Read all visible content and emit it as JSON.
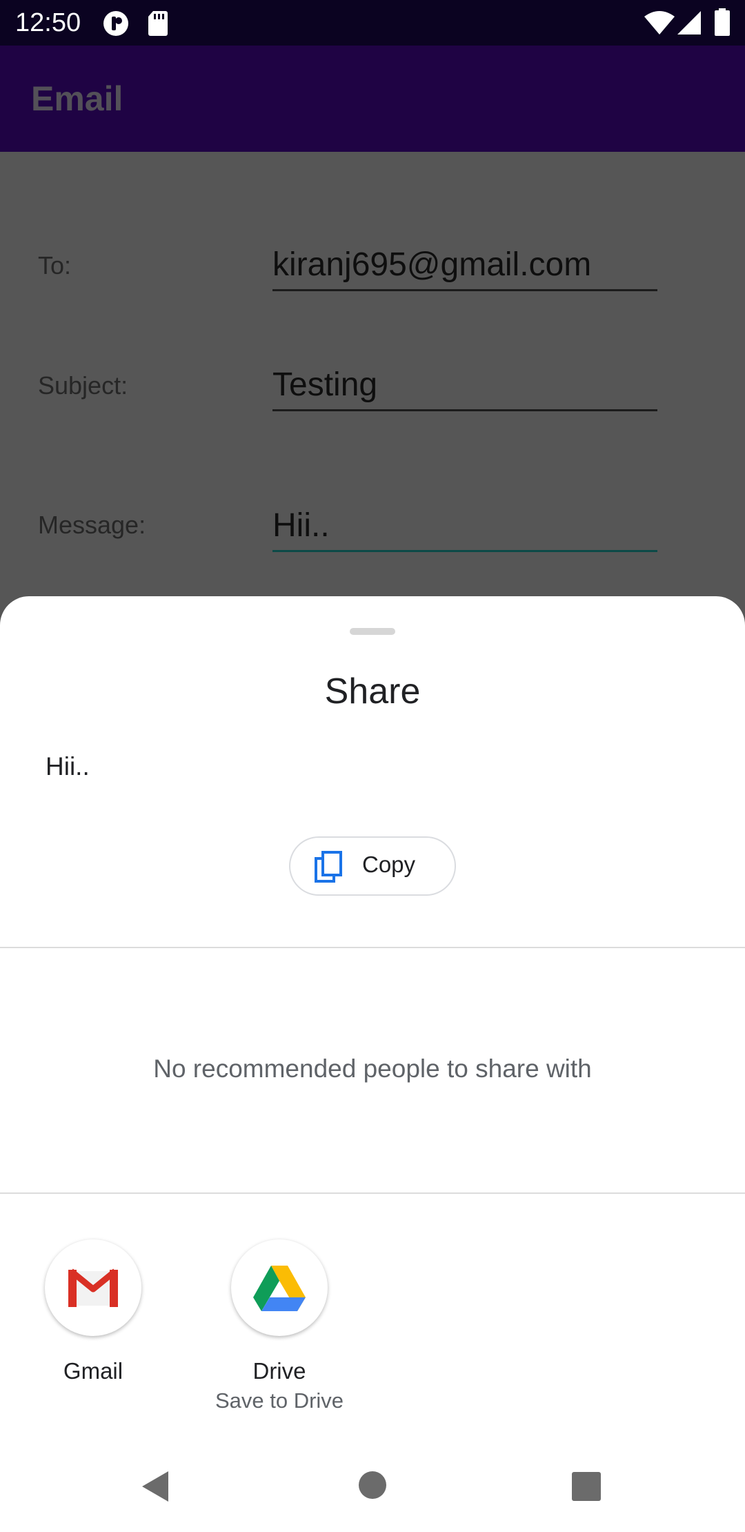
{
  "status_bar": {
    "time": "12:50",
    "icons": [
      "notification-app-icon",
      "sd-card-icon",
      "wifi-icon",
      "signal-icon",
      "battery-icon"
    ]
  },
  "app_bar": {
    "title": "Email"
  },
  "form": {
    "to_label": "To:",
    "to_value": "kiranj695@gmail.com",
    "subject_label": "Subject:",
    "subject_value": "Testing",
    "message_label": "Message:",
    "message_value": "Hii.."
  },
  "share_sheet": {
    "title": "Share",
    "preview_text": "Hii..",
    "copy_label": "Copy",
    "no_recommendations": "No recommended people to share with",
    "apps": [
      {
        "name": "Gmail",
        "subtitle": "",
        "icon": "gmail-icon"
      },
      {
        "name": "Drive",
        "subtitle": "Save to Drive",
        "icon": "google-drive-icon"
      }
    ]
  },
  "colors": {
    "status_bar": "#0b0321",
    "app_bar": "#1f0344",
    "scrim": "#565656",
    "active_underline": "#0c4a47",
    "copy_icon": "#1a73e8"
  },
  "nav_bar": {
    "buttons": [
      "back-icon",
      "home-icon",
      "recents-icon"
    ]
  }
}
